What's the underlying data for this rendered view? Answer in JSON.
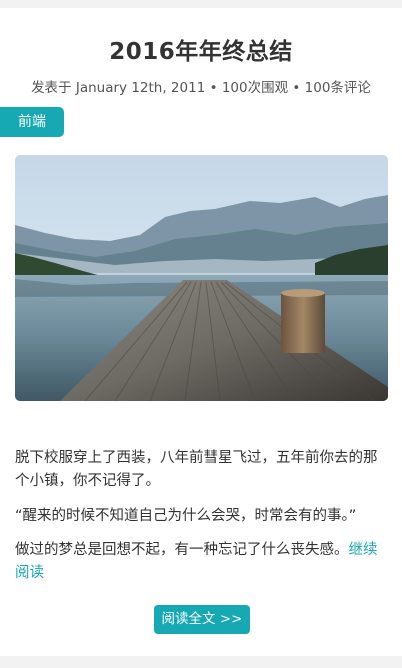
{
  "post": {
    "title": "2016年年终总结",
    "meta": "发表于 January 12th, 2011 • 100次围观 • 100条评论",
    "category": "前端",
    "image": "lake-pier-mountains-photo",
    "paragraphs": [
      "脱下校服穿上了西装，八年前彗星飞过，五年前你去的那个小镇，你不记得了。",
      "“醒来的时候不知道自己为什么会哭，时常会有的事。”",
      "做过的梦总是回想不起，有一种忘记了什么丧失感。"
    ],
    "continue_link": "继续阅读",
    "read_full_button": "阅读全文 >>"
  },
  "colors": {
    "accent": "#16a9b3",
    "text": "#333333",
    "meta": "#555555",
    "background": "#f2f2f2"
  }
}
